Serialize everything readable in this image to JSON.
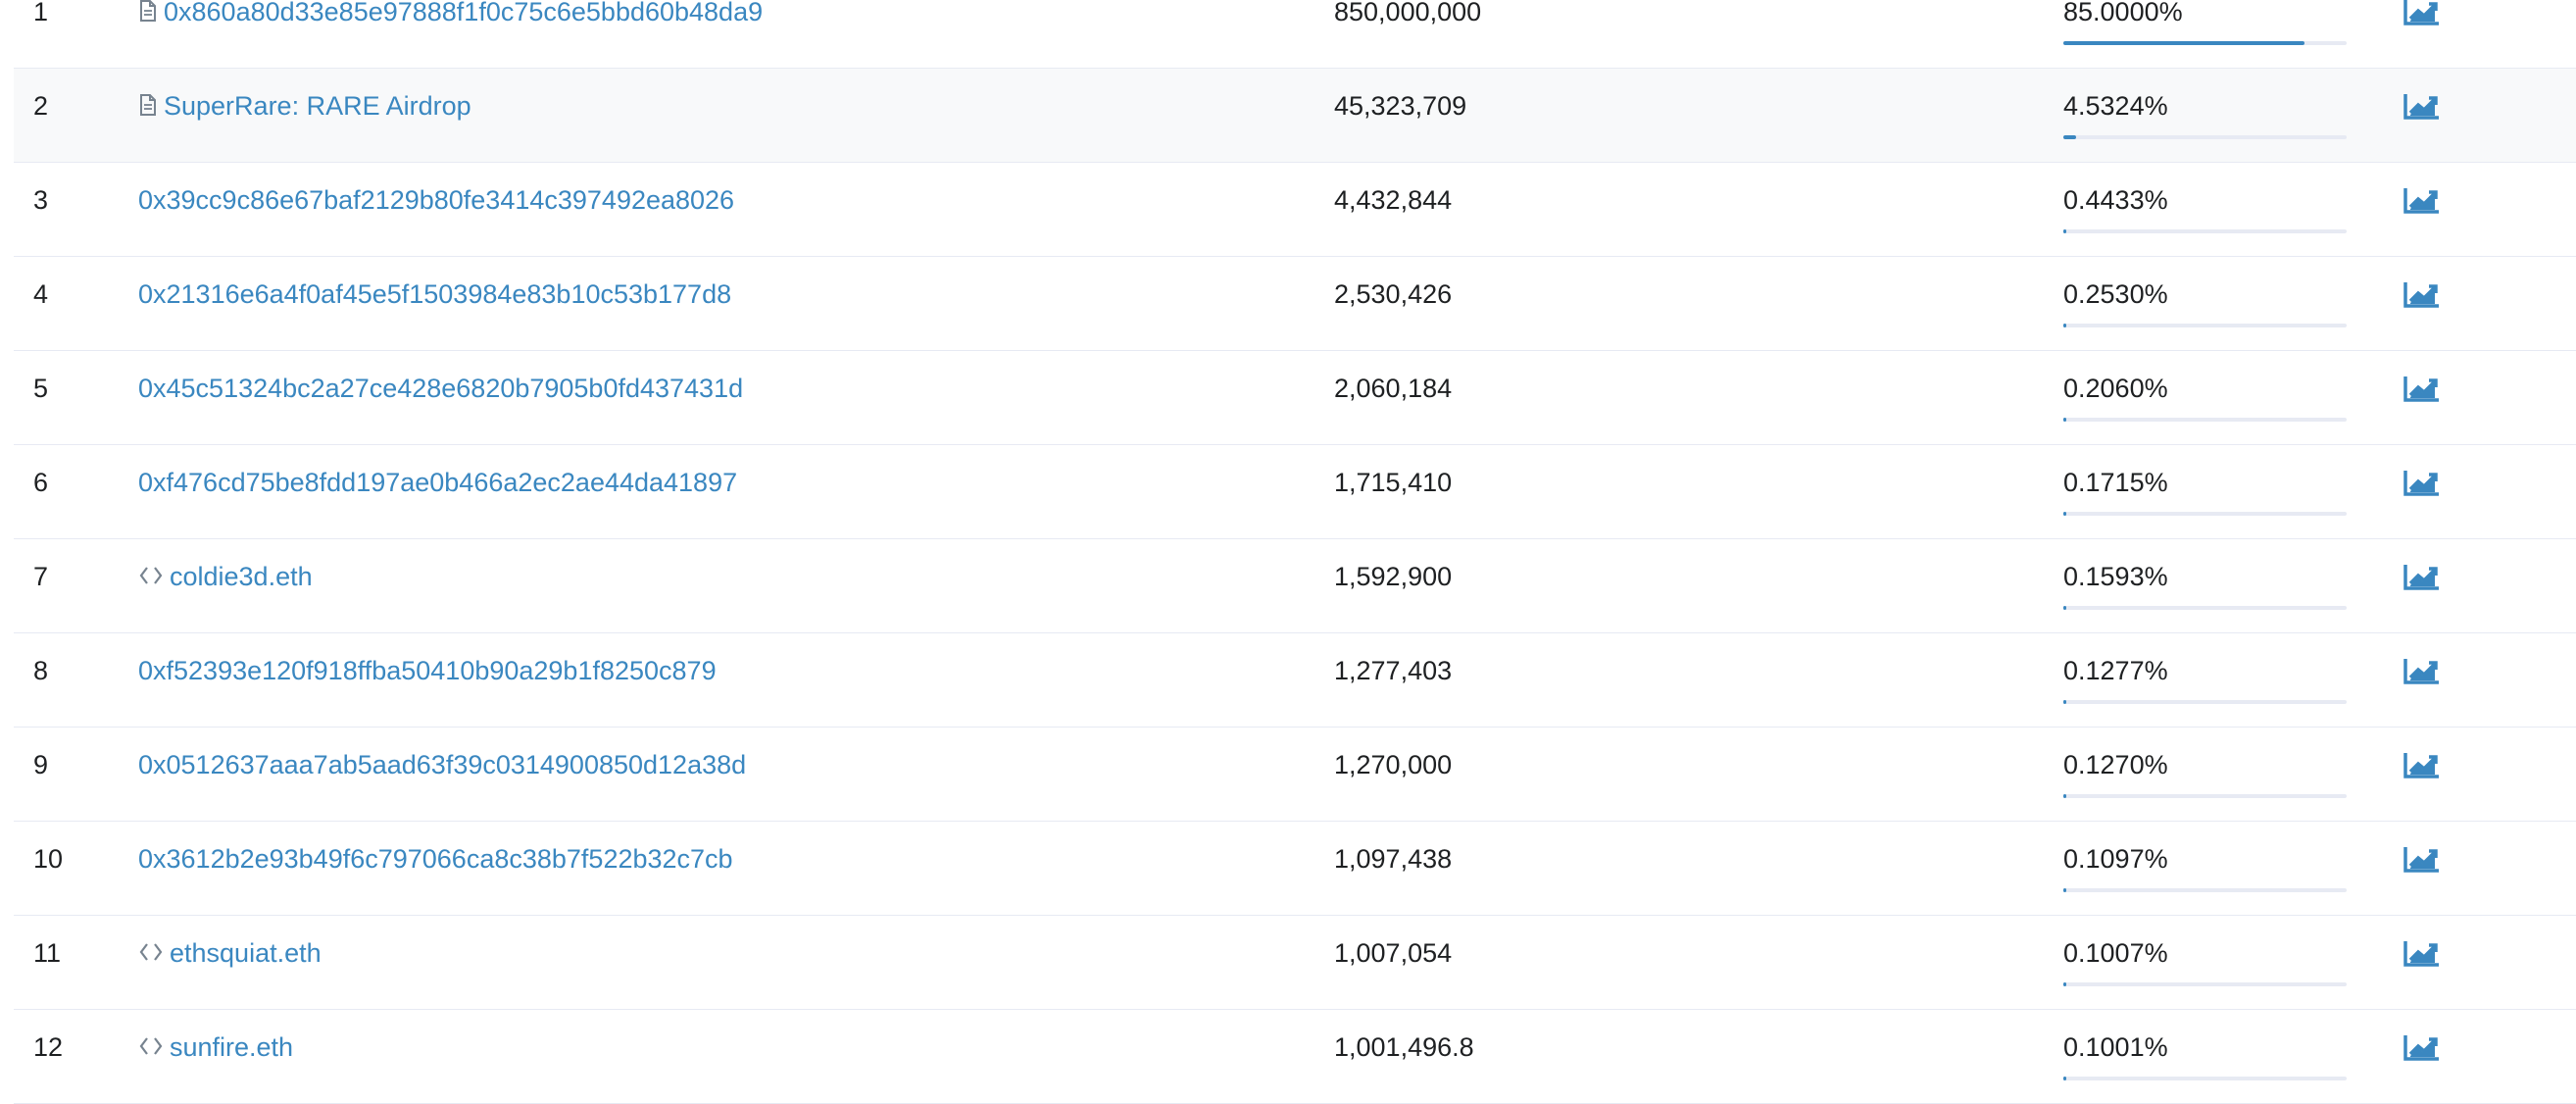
{
  "holders": [
    {
      "rank": "1",
      "address": "0x860a80d33e85e97888f1f0c75c6e5bbd60b48da9",
      "icon": "contract-icon",
      "quantity": "850,000,000",
      "percentage": "85.0000%",
      "share": 0.85
    },
    {
      "rank": "2",
      "address": "SuperRare: RARE Airdrop",
      "icon": "contract-icon",
      "quantity": "45,323,709",
      "percentage": "4.5324%",
      "share": 0.045324
    },
    {
      "rank": "3",
      "address": "0x39cc9c86e67baf2129b80fe3414c397492ea8026",
      "icon": "",
      "quantity": "4,432,844",
      "percentage": "0.4433%",
      "share": 0.004433
    },
    {
      "rank": "4",
      "address": "0x21316e6a4f0af45e5f1503984e83b10c53b177d8",
      "icon": "",
      "quantity": "2,530,426",
      "percentage": "0.2530%",
      "share": 0.00253
    },
    {
      "rank": "5",
      "address": "0x45c51324bc2a27ce428e6820b7905b0fd437431d",
      "icon": "",
      "quantity": "2,060,184",
      "percentage": "0.2060%",
      "share": 0.00206
    },
    {
      "rank": "6",
      "address": "0xf476cd75be8fdd197ae0b466a2ec2ae44da41897",
      "icon": "",
      "quantity": "1,715,410",
      "percentage": "0.1715%",
      "share": 0.001715
    },
    {
      "rank": "7",
      "address": "coldie3d.eth",
      "icon": "ens-icon",
      "quantity": "1,592,900",
      "percentage": "0.1593%",
      "share": 0.001593
    },
    {
      "rank": "8",
      "address": "0xf52393e120f918ffba50410b90a29b1f8250c879",
      "icon": "",
      "quantity": "1,277,403",
      "percentage": "0.1277%",
      "share": 0.001277
    },
    {
      "rank": "9",
      "address": "0x0512637aaa7ab5aad63f39c0314900850d12a38d",
      "icon": "",
      "quantity": "1,270,000",
      "percentage": "0.1270%",
      "share": 0.00127
    },
    {
      "rank": "10",
      "address": "0x3612b2e93b49f6c797066ca8c38b7f522b32c7cb",
      "icon": "",
      "quantity": "1,097,438",
      "percentage": "0.1097%",
      "share": 0.001097
    },
    {
      "rank": "11",
      "address": "ethsquiat.eth",
      "icon": "ens-icon",
      "quantity": "1,007,054",
      "percentage": "0.1007%",
      "share": 0.001007
    },
    {
      "rank": "12",
      "address": "sunfire.eth",
      "icon": "ens-icon",
      "quantity": "1,001,496.8",
      "percentage": "0.1001%",
      "share": 0.001001
    }
  ],
  "colors": {
    "link": "#3a87c0",
    "bar_fill": "#3a87c0",
    "bar_track": "#e7eaf3",
    "highlight_row": "#f8f9fa"
  },
  "highlighted_rank": "2"
}
